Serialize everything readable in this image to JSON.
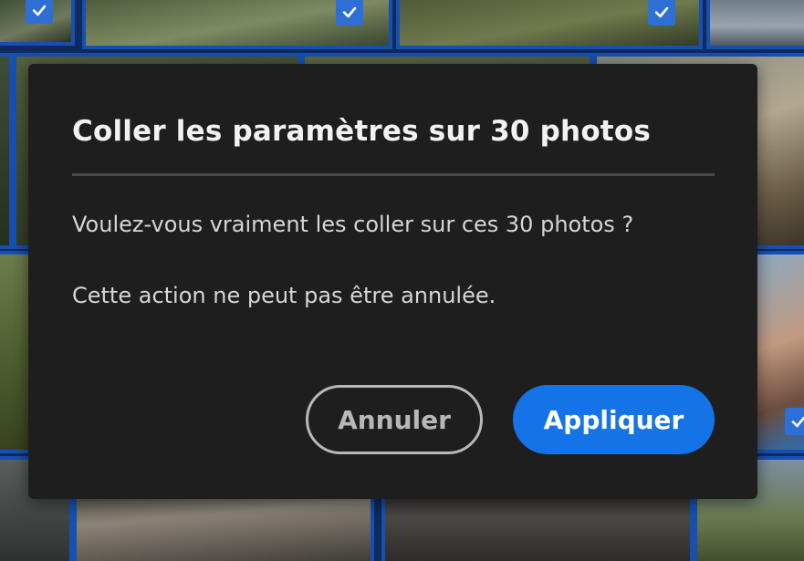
{
  "dialog": {
    "title": "Coller les paramètres sur 30 photos",
    "message_line1": "Voulez-vous vraiment les coller sur ces 30 photos ?",
    "message_line2": "Cette action ne peut pas être annulée.",
    "cancel_label": "Annuler",
    "apply_label": "Appliquer"
  },
  "colors": {
    "dialog_background": "#1e1e1e",
    "accent": "#1473e6",
    "selection_border": "#1650b0",
    "checkbox": "#2d6fd6"
  },
  "icons": {
    "selected_checkbox": "checkmark-icon"
  }
}
